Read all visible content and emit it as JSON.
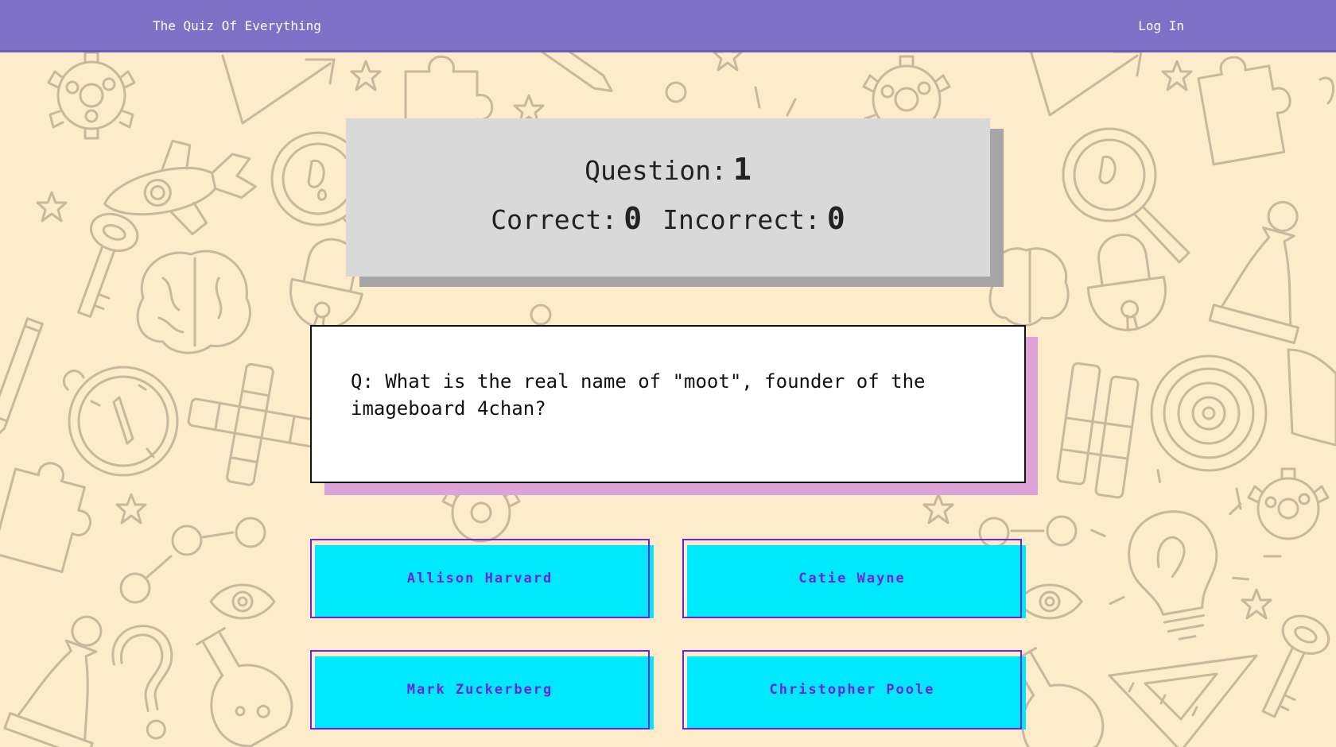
{
  "navbar": {
    "brand": "The Quiz Of Everything",
    "login_label": "Log In",
    "color": "#7e6fc7"
  },
  "score": {
    "question_label": "Question:",
    "question_number": "1",
    "correct_label": "Correct:",
    "correct_count": "0",
    "incorrect_label": "Incorrect:",
    "incorrect_count": "0"
  },
  "question": {
    "text": "Q: What is the real name of \"moot\", founder of the imageboard 4chan?"
  },
  "answers": [
    {
      "label": "Allison Harvard"
    },
    {
      "label": "Catie Wayne"
    },
    {
      "label": "Mark Zuckerberg"
    },
    {
      "label": "Christopher Poole"
    }
  ],
  "colors": {
    "background": "#feebc9",
    "doodle_stroke": "#c9b79e",
    "score_card": "#d9d9d9",
    "question_shadow": "#dfa3da",
    "answer_fill": "#00e8fc",
    "answer_accent": "#6d25d9"
  },
  "background_icons": [
    "gear-icon",
    "rocket-icon",
    "puzzle-icon",
    "magnifier-icon",
    "padlock-icon",
    "brain-icon",
    "key-icon",
    "compass-icon",
    "crossword-icon",
    "lightbulb-icon",
    "chess-pawn-icon",
    "question-mark-icon",
    "star-icon",
    "pencil-icon",
    "eye-icon",
    "flask-icon",
    "target-icon",
    "triangle-ruler-icon",
    "arrow-icon"
  ]
}
